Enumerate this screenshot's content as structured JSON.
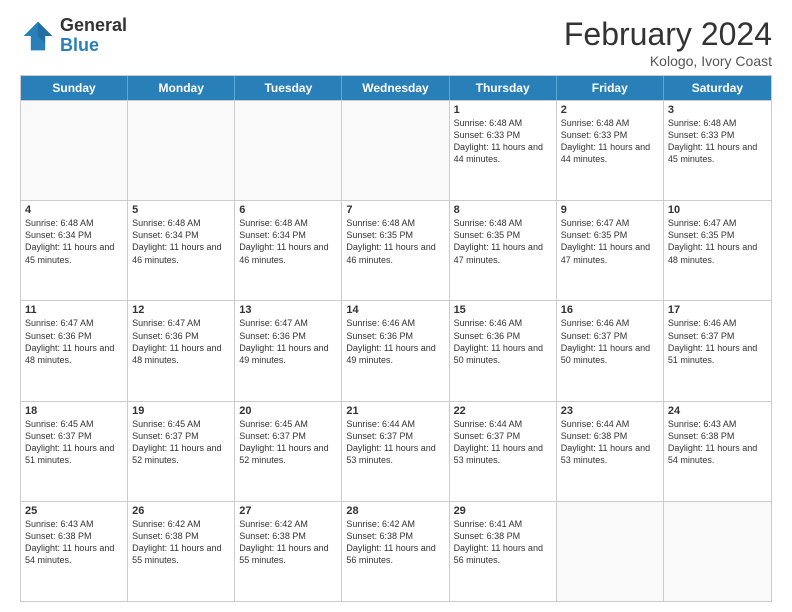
{
  "logo": {
    "general": "General",
    "blue": "Blue"
  },
  "header": {
    "title": "February 2024",
    "subtitle": "Kologo, Ivory Coast"
  },
  "days_of_week": [
    "Sunday",
    "Monday",
    "Tuesday",
    "Wednesday",
    "Thursday",
    "Friday",
    "Saturday"
  ],
  "rows": [
    [
      {
        "day": "",
        "info": ""
      },
      {
        "day": "",
        "info": ""
      },
      {
        "day": "",
        "info": ""
      },
      {
        "day": "",
        "info": ""
      },
      {
        "day": "1",
        "info": "Sunrise: 6:48 AM\nSunset: 6:33 PM\nDaylight: 11 hours and 44 minutes."
      },
      {
        "day": "2",
        "info": "Sunrise: 6:48 AM\nSunset: 6:33 PM\nDaylight: 11 hours and 44 minutes."
      },
      {
        "day": "3",
        "info": "Sunrise: 6:48 AM\nSunset: 6:33 PM\nDaylight: 11 hours and 45 minutes."
      }
    ],
    [
      {
        "day": "4",
        "info": "Sunrise: 6:48 AM\nSunset: 6:34 PM\nDaylight: 11 hours and 45 minutes."
      },
      {
        "day": "5",
        "info": "Sunrise: 6:48 AM\nSunset: 6:34 PM\nDaylight: 11 hours and 46 minutes."
      },
      {
        "day": "6",
        "info": "Sunrise: 6:48 AM\nSunset: 6:34 PM\nDaylight: 11 hours and 46 minutes."
      },
      {
        "day": "7",
        "info": "Sunrise: 6:48 AM\nSunset: 6:35 PM\nDaylight: 11 hours and 46 minutes."
      },
      {
        "day": "8",
        "info": "Sunrise: 6:48 AM\nSunset: 6:35 PM\nDaylight: 11 hours and 47 minutes."
      },
      {
        "day": "9",
        "info": "Sunrise: 6:47 AM\nSunset: 6:35 PM\nDaylight: 11 hours and 47 minutes."
      },
      {
        "day": "10",
        "info": "Sunrise: 6:47 AM\nSunset: 6:35 PM\nDaylight: 11 hours and 48 minutes."
      }
    ],
    [
      {
        "day": "11",
        "info": "Sunrise: 6:47 AM\nSunset: 6:36 PM\nDaylight: 11 hours and 48 minutes."
      },
      {
        "day": "12",
        "info": "Sunrise: 6:47 AM\nSunset: 6:36 PM\nDaylight: 11 hours and 48 minutes."
      },
      {
        "day": "13",
        "info": "Sunrise: 6:47 AM\nSunset: 6:36 PM\nDaylight: 11 hours and 49 minutes."
      },
      {
        "day": "14",
        "info": "Sunrise: 6:46 AM\nSunset: 6:36 PM\nDaylight: 11 hours and 49 minutes."
      },
      {
        "day": "15",
        "info": "Sunrise: 6:46 AM\nSunset: 6:36 PM\nDaylight: 11 hours and 50 minutes."
      },
      {
        "day": "16",
        "info": "Sunrise: 6:46 AM\nSunset: 6:37 PM\nDaylight: 11 hours and 50 minutes."
      },
      {
        "day": "17",
        "info": "Sunrise: 6:46 AM\nSunset: 6:37 PM\nDaylight: 11 hours and 51 minutes."
      }
    ],
    [
      {
        "day": "18",
        "info": "Sunrise: 6:45 AM\nSunset: 6:37 PM\nDaylight: 11 hours and 51 minutes."
      },
      {
        "day": "19",
        "info": "Sunrise: 6:45 AM\nSunset: 6:37 PM\nDaylight: 11 hours and 52 minutes."
      },
      {
        "day": "20",
        "info": "Sunrise: 6:45 AM\nSunset: 6:37 PM\nDaylight: 11 hours and 52 minutes."
      },
      {
        "day": "21",
        "info": "Sunrise: 6:44 AM\nSunset: 6:37 PM\nDaylight: 11 hours and 53 minutes."
      },
      {
        "day": "22",
        "info": "Sunrise: 6:44 AM\nSunset: 6:37 PM\nDaylight: 11 hours and 53 minutes."
      },
      {
        "day": "23",
        "info": "Sunrise: 6:44 AM\nSunset: 6:38 PM\nDaylight: 11 hours and 53 minutes."
      },
      {
        "day": "24",
        "info": "Sunrise: 6:43 AM\nSunset: 6:38 PM\nDaylight: 11 hours and 54 minutes."
      }
    ],
    [
      {
        "day": "25",
        "info": "Sunrise: 6:43 AM\nSunset: 6:38 PM\nDaylight: 11 hours and 54 minutes."
      },
      {
        "day": "26",
        "info": "Sunrise: 6:42 AM\nSunset: 6:38 PM\nDaylight: 11 hours and 55 minutes."
      },
      {
        "day": "27",
        "info": "Sunrise: 6:42 AM\nSunset: 6:38 PM\nDaylight: 11 hours and 55 minutes."
      },
      {
        "day": "28",
        "info": "Sunrise: 6:42 AM\nSunset: 6:38 PM\nDaylight: 11 hours and 56 minutes."
      },
      {
        "day": "29",
        "info": "Sunrise: 6:41 AM\nSunset: 6:38 PM\nDaylight: 11 hours and 56 minutes."
      },
      {
        "day": "",
        "info": ""
      },
      {
        "day": "",
        "info": ""
      }
    ]
  ]
}
